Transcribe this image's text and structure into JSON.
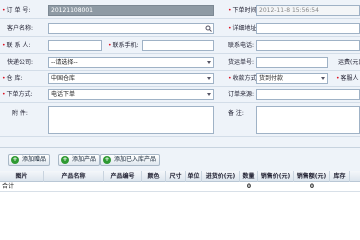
{
  "form": {
    "order_no_label": "订 单 号:",
    "order_no_value": "20121108001",
    "order_time_label": "下单时间:",
    "order_time_value": "2012-11-8 15:56:54",
    "customer_label": "客户名称:",
    "customer_value": "",
    "address_label": "详细地址:",
    "address_value": "",
    "contact_label": "联 系 人:",
    "contact_value": "",
    "mobile_label": "联系手机:",
    "mobile_value": "",
    "phone_label": "联系电话:",
    "phone_value": "",
    "express_label": "快递公司:",
    "express_value": "--请选择--",
    "tracking_label": "货运单号:",
    "tracking_value": "",
    "freight_label": "运费(元)",
    "warehouse_label": "仓   库:",
    "warehouse_value": "中国仓库",
    "payment_label": "收款方式:",
    "payment_value": "货到付款",
    "customer_service_label": "客服人",
    "order_method_label": "下单方式:",
    "order_method_value": "电话下单",
    "order_source_label": "订单来源:",
    "order_source_value": "",
    "attachment_label": "附    件:",
    "remark_label": "备    注:"
  },
  "toolbar": {
    "add_gift": "添加赠品",
    "add_product": "添加产品",
    "add_stocked_product": "添加已入库产品"
  },
  "grid": {
    "headers": [
      "图片",
      "产品名称",
      "产品编号",
      "颜色",
      "尺寸",
      "单位",
      "进货价(元)",
      "数量",
      "销售价(元)",
      "销售额(元)",
      "库存"
    ],
    "total_label": "合计",
    "total_quantity": "0",
    "total_sales": "0"
  },
  "icons": {
    "calendar": "calendar-icon",
    "lookup": "lookup-icon",
    "add": "add-icon"
  },
  "colors": {
    "background": "#eef3f9",
    "required": "#d12",
    "button_icon": "#2e9a32"
  }
}
